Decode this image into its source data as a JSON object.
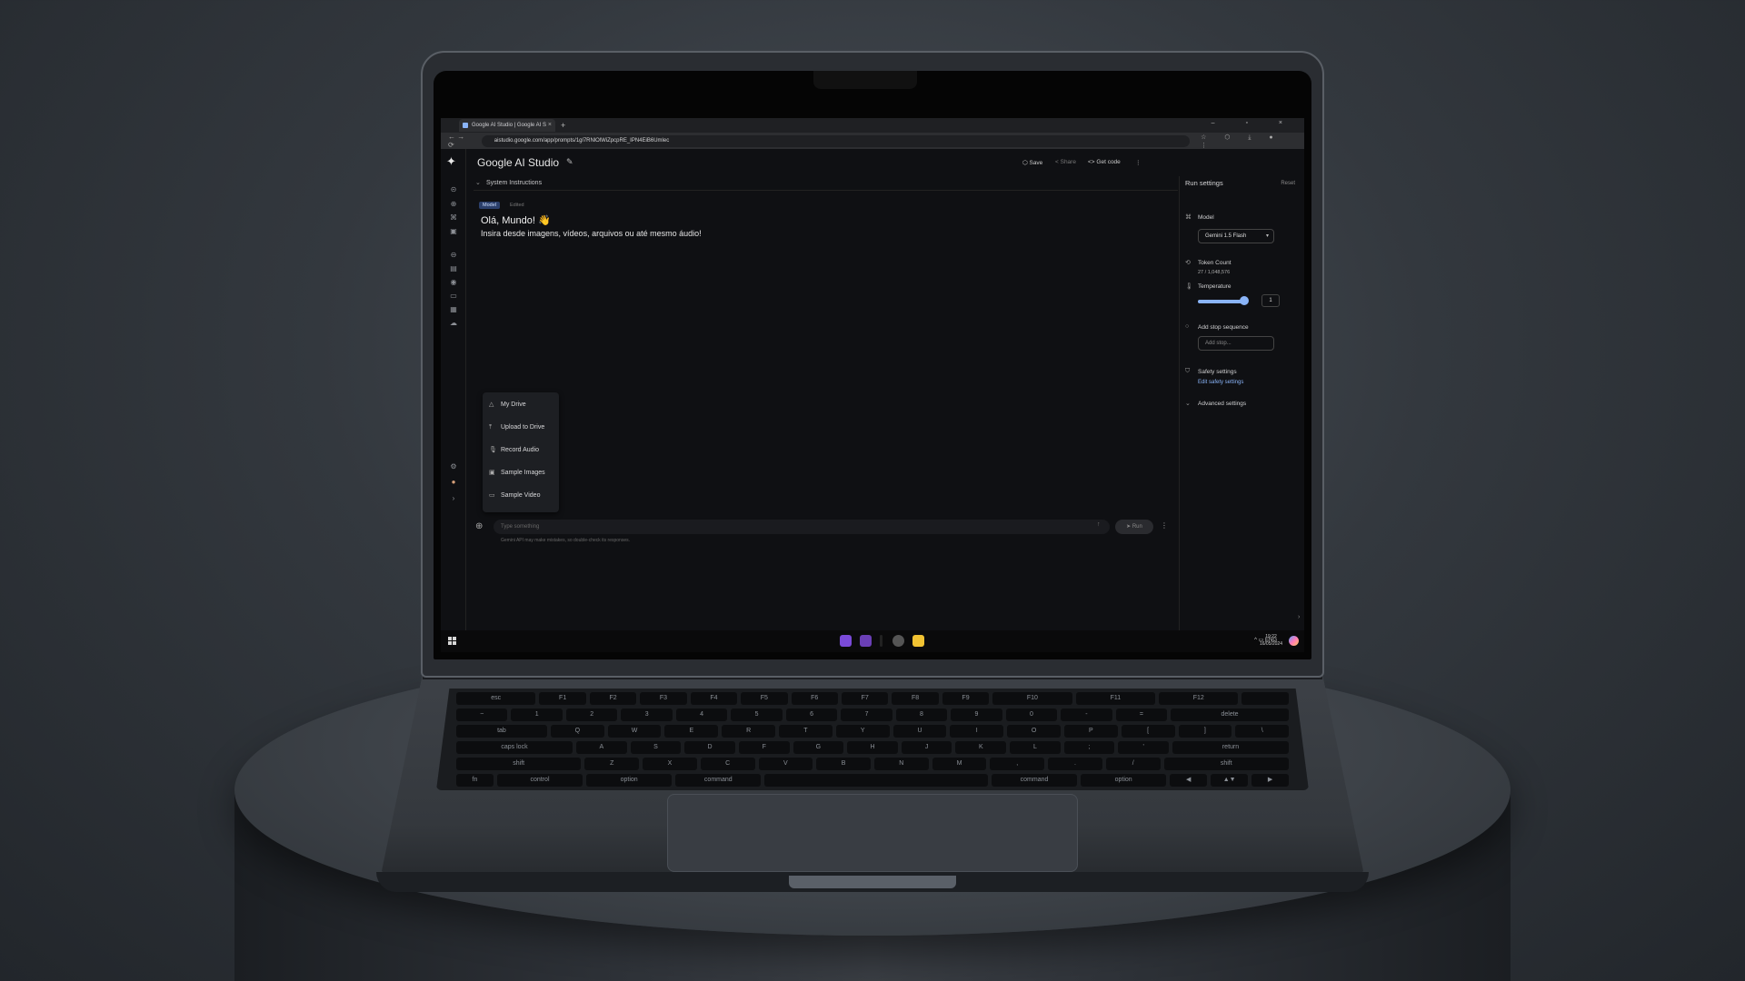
{
  "browser": {
    "tab_title": "Google AI Studio | Google AI S",
    "tab_close": "×",
    "new_tab": "+",
    "window_controls": "– ▫ ×",
    "nav": "← → ⟳",
    "url": "aistudio.google.com/app/prompts/1gl7RNlOlWiZpcpRE_IPN4EiB6Umlec",
    "addr_icons": "☆ ⬡ ⤓ ● ⋮"
  },
  "app": {
    "title": "Google AI Studio",
    "actions": {
      "save": "Save",
      "share": "Share",
      "get_code": "Get code",
      "more": "⋮"
    },
    "system_instructions": "System Instructions",
    "message": {
      "badge": "Model",
      "edited": "Edited",
      "greeting": "Olá, Mundo! 👋",
      "body": "Insira desde imagens, vídeos, arquivos ou até mesmo áudio!"
    },
    "menu": [
      {
        "label": "My Drive",
        "icon": "drive-icon"
      },
      {
        "label": "Upload to Drive",
        "icon": "upload-icon"
      },
      {
        "label": "Record Audio",
        "icon": "microphone-icon"
      },
      {
        "label": "Sample Images",
        "icon": "image-icon"
      },
      {
        "label": "Sample Video",
        "icon": "video-icon"
      }
    ],
    "prompt": {
      "placeholder": "Type something",
      "run": "Run",
      "disclaimer": "Gemini API may make mistakes, so double-check its responses."
    }
  },
  "run_settings": {
    "title": "Run settings",
    "reset": "Reset",
    "model_label": "Model",
    "model_value": "Gemini 1.5 Flash",
    "token_label": "Token Count",
    "token_value": "27 / 1,048,576",
    "temperature_label": "Temperature",
    "temperature_value": "1",
    "temperature_level": 0.8,
    "stop_label": "Add stop sequence",
    "stop_placeholder": "Add stop...",
    "safety_label": "Safety settings",
    "safety_link": "Edit safety settings",
    "advanced_label": "Advanced settings"
  },
  "taskbar": {
    "tray": "^ ▭ ENG",
    "time": "19:22",
    "date": "16/05/2024"
  },
  "keyboard": {
    "rows": [
      [
        "esc",
        "F1",
        "F2",
        "F3",
        "F4",
        "F5",
        "F6",
        "F7",
        "F8",
        "F9",
        "F10",
        "F11",
        "F12",
        ""
      ],
      [
        "~",
        "1",
        "2",
        "3",
        "4",
        "5",
        "6",
        "7",
        "8",
        "9",
        "0",
        "-",
        "=",
        "delete"
      ],
      [
        "tab",
        "Q",
        "W",
        "E",
        "R",
        "T",
        "Y",
        "U",
        "I",
        "O",
        "P",
        "[",
        "]",
        "\\"
      ],
      [
        "caps lock",
        "A",
        "S",
        "D",
        "F",
        "G",
        "H",
        "J",
        "K",
        "L",
        ";",
        "'",
        "return"
      ],
      [
        "shift",
        "Z",
        "X",
        "C",
        "V",
        "B",
        "N",
        "M",
        ",",
        ".",
        "/",
        "shift"
      ],
      [
        "fn",
        "control",
        "option",
        "command",
        "",
        "command",
        "option",
        "◀",
        "▲▼",
        "▶"
      ]
    ]
  },
  "colors": {
    "accent": "#8ab4f8",
    "background": "#0f1013"
  }
}
